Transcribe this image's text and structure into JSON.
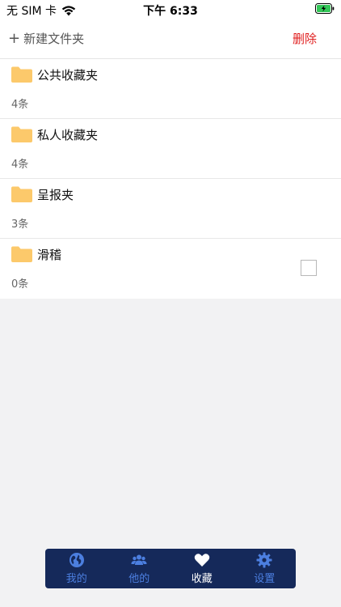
{
  "status_bar": {
    "carrier": "无 SIM 卡",
    "time": "下午 6:33"
  },
  "navbar": {
    "new_folder_label": "新建文件夹",
    "delete_label": "删除"
  },
  "folders": [
    {
      "name": "公共收藏夹",
      "count": "4条"
    },
    {
      "name": "私人收藏夹",
      "count": "4条"
    },
    {
      "name": "呈报夹",
      "count": "3条"
    },
    {
      "name": "滑稽",
      "count": "0条"
    }
  ],
  "tabbar": {
    "tabs": [
      {
        "label": "我的",
        "icon": "globe-icon",
        "active": false
      },
      {
        "label": "他的",
        "icon": "users-icon",
        "active": false
      },
      {
        "label": "收藏",
        "icon": "heart-icon",
        "active": true
      },
      {
        "label": "设置",
        "icon": "gear-icon",
        "active": false
      }
    ]
  },
  "colors": {
    "delete": "#e02020",
    "folder": "#fcc96b",
    "tabbar_bg": "#15295a",
    "tab_inactive": "#4c7fe0",
    "tab_active": "#ffffff"
  }
}
